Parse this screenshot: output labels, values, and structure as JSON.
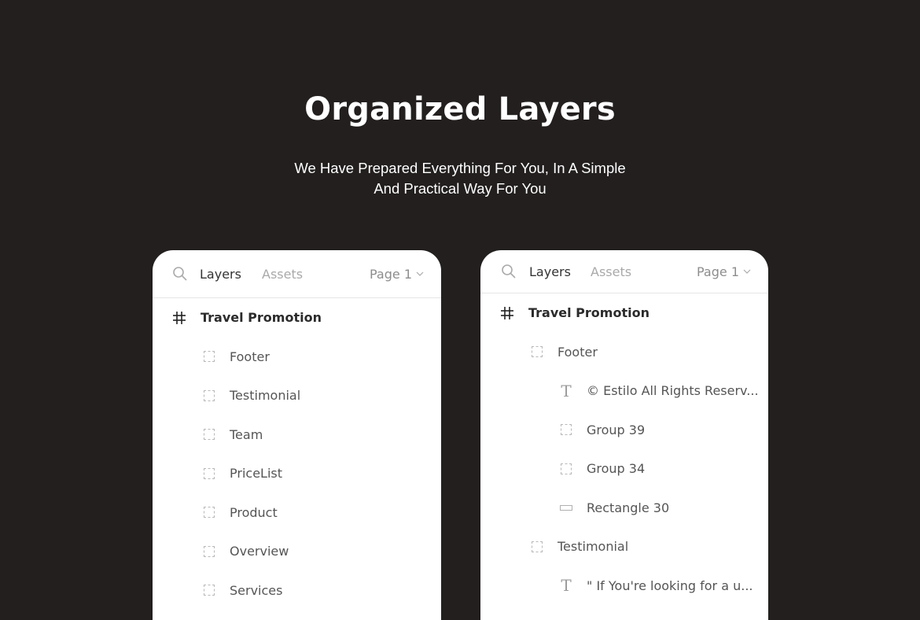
{
  "hero": {
    "title": "Organized Layers",
    "subtitle_line1": "We Have Prepared Everything For You, In A Simple",
    "subtitle_line2": "And Practical Way For You"
  },
  "colors": {
    "background": "#231f1f",
    "panel": "#ffffff",
    "active_tab": "#333333",
    "inactive_tab": "#a9a9a9"
  },
  "left_panel": {
    "tabs": {
      "layers": "Layers",
      "assets": "Assets"
    },
    "page_select": "Page 1",
    "frame": {
      "icon": "frame-hash-icon",
      "label": "Travel Promotion"
    },
    "layers": [
      {
        "icon": "group-icon",
        "label": "Footer"
      },
      {
        "icon": "group-icon",
        "label": "Testimonial"
      },
      {
        "icon": "group-icon",
        "label": "Team"
      },
      {
        "icon": "group-icon",
        "label": "PriceList"
      },
      {
        "icon": "group-icon",
        "label": "Product"
      },
      {
        "icon": "group-icon",
        "label": "Overview"
      },
      {
        "icon": "group-icon",
        "label": "Services"
      }
    ]
  },
  "right_panel": {
    "tabs": {
      "layers": "Layers",
      "assets": "Assets"
    },
    "page_select": "Page 1",
    "frame": {
      "icon": "frame-hash-icon",
      "label": "Travel Promotion"
    },
    "layers": [
      {
        "level": 1,
        "icon": "group-icon",
        "label": "Footer"
      },
      {
        "level": 2,
        "icon": "text-icon",
        "label": "© Estilo All Rights Reserv..."
      },
      {
        "level": 2,
        "icon": "group-icon",
        "label": "Group 39"
      },
      {
        "level": 2,
        "icon": "group-icon",
        "label": "Group 34"
      },
      {
        "level": 2,
        "icon": "rectangle-icon",
        "label": "Rectangle 30"
      },
      {
        "level": 1,
        "icon": "group-icon",
        "label": "Testimonial"
      },
      {
        "level": 2,
        "icon": "text-icon",
        "label": "\" If You're looking for a u..."
      }
    ]
  }
}
